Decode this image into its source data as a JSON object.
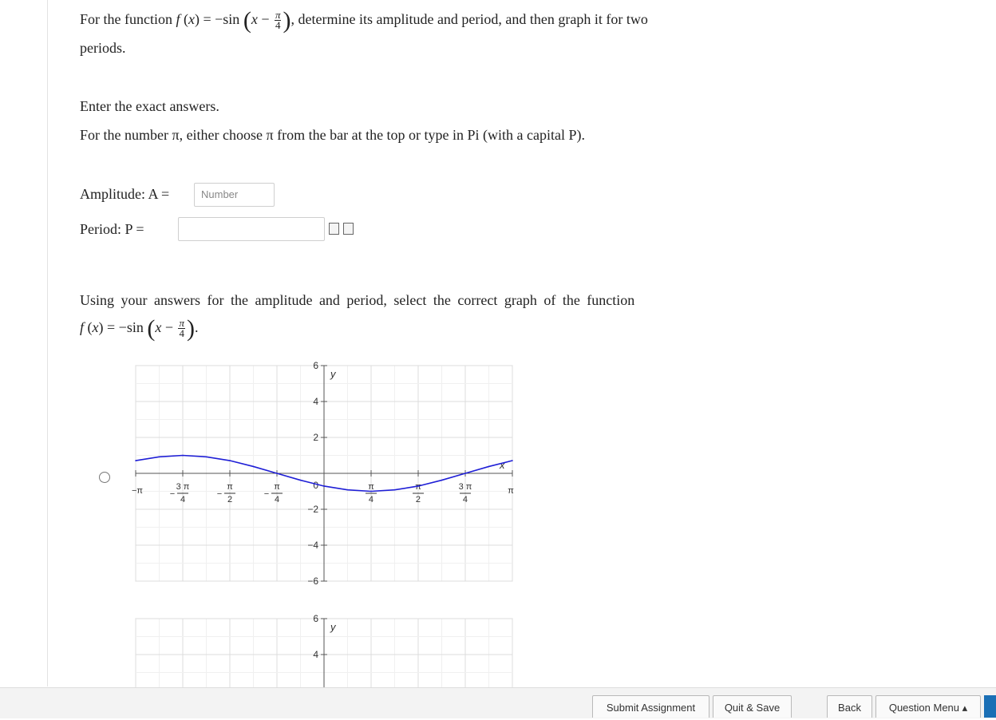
{
  "question": {
    "intro_pre": "For the function",
    "intro_post": ", determine its amplitude and period, and then graph it for two",
    "intro_line2": "periods.",
    "func": {
      "lhs": "f",
      "var": "x",
      "eq": "= −sin",
      "minus": "−",
      "frac_num": "π",
      "frac_den": "4"
    },
    "instruction_1": "Enter the exact answers.",
    "instruction_2": "For the number π, either choose π from the bar at the top or type in Pi (with a capital P).",
    "amplitude_label": "Amplitude: A =",
    "amplitude_placeholder": "Number",
    "period_label": "Period: P =",
    "graph_prompt": "Using your answers for the amplitude and period, select the correct graph of the function"
  },
  "graph1": {
    "y_ticks": [
      "6",
      "4",
      "2",
      "0",
      "−2",
      "−4",
      "−6"
    ],
    "y_axis_label": "y",
    "x_axis_label": "x",
    "x_ticks": [
      {
        "prefix": "−",
        "num": "π",
        "den": ""
      },
      {
        "prefix": "−",
        "num": "3 π",
        "den": "4"
      },
      {
        "prefix": "−",
        "num": "π",
        "den": "2"
      },
      {
        "prefix": "−",
        "num": "π",
        "den": "4"
      },
      {
        "prefix": "",
        "num": "π",
        "den": "4"
      },
      {
        "prefix": "",
        "num": "π",
        "den": "2"
      },
      {
        "prefix": "",
        "num": "3 π",
        "den": "4"
      },
      {
        "prefix": "",
        "num": "π",
        "den": ""
      }
    ]
  },
  "chart_data": {
    "type": "line",
    "xlabel": "x",
    "ylabel": "y",
    "xlim": [
      -3.1416,
      3.1416
    ],
    "ylim": [
      -6,
      6
    ],
    "grid": true,
    "series": [
      {
        "color": "#1f1fd6",
        "x": [
          -3.1416,
          -2.7489,
          -2.3562,
          -1.9635,
          -1.5708,
          -1.1781,
          -0.7854,
          -0.3927,
          0,
          0.3927,
          0.7854,
          1.1781,
          1.5708,
          1.9635,
          2.3562,
          2.7489,
          3.1416
        ],
        "y": [
          0.71,
          0.92,
          1.0,
          0.92,
          0.71,
          0.38,
          0.0,
          -0.38,
          -0.71,
          -0.92,
          -1.0,
          -0.92,
          -0.71,
          -0.38,
          0.0,
          0.38,
          0.71
        ]
      }
    ]
  },
  "graph2": {
    "y_ticks": [
      "6",
      "4"
    ],
    "y_axis_label": "y"
  },
  "footer": {
    "submit": "Submit Assignment",
    "quit": "Quit & Save",
    "back": "Back",
    "menu": "Question Menu ▴"
  }
}
